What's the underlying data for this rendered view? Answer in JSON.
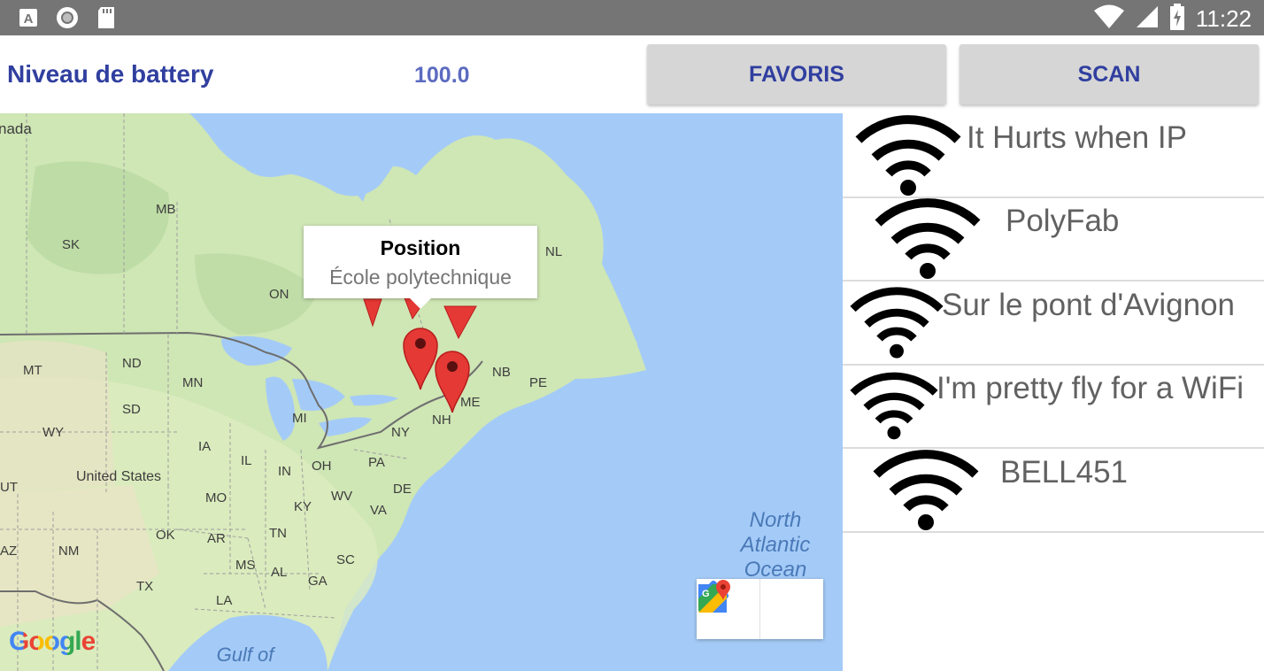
{
  "status_bar": {
    "time": "11:22",
    "left_icons": [
      "text-a-icon",
      "circle-icon",
      "sd-card-icon"
    ],
    "right_icons": [
      "wifi-signal-icon",
      "cell-signal-icon",
      "battery-charging-icon"
    ]
  },
  "header": {
    "battery_label": "Niveau de battery",
    "battery_value": "100.0",
    "favoris_label": "FAVORIS",
    "scan_label": "SCAN",
    "accent_color": "#303f9f"
  },
  "map": {
    "info_window": {
      "title": "Position",
      "subtitle": "École polytechnique"
    },
    "labels": {
      "canada": "nada",
      "mb": "MB",
      "sk": "SK",
      "on": "ON",
      "nl": "NL",
      "mt": "MT",
      "nd": "ND",
      "mn": "MN",
      "sd": "SD",
      "wy": "WY",
      "mi": "MI",
      "nb": "NB",
      "pe": "PE",
      "me": "ME",
      "nh": "NH",
      "ny": "NY",
      "ia": "IA",
      "il": "IL",
      "in": "IN",
      "oh": "OH",
      "pa": "PA",
      "ut": "UT",
      "us": "United States",
      "de": "DE",
      "mo": "MO",
      "ky": "KY",
      "wv": "WV",
      "va": "VA",
      "ok": "OK",
      "ar": "AR",
      "tn": "TN",
      "az": "AZ",
      "nm": "NM",
      "ms": "MS",
      "al": "AL",
      "sc": "SC",
      "ga": "GA",
      "tx": "TX",
      "la": "LA"
    },
    "ocean_label": "North\nAtlantic\nOcean",
    "gulf_label": "Gulf of\nMexico",
    "logo": "Google",
    "toolbar": [
      "directions-icon",
      "google-maps-icon"
    ]
  },
  "wifi_networks": [
    {
      "name": "It Hurts when IP"
    },
    {
      "name": "PolyFab"
    },
    {
      "name": "Sur le pont d'Avignon"
    },
    {
      "name": "I'm pretty fly for a WiFi"
    },
    {
      "name": "BELL451"
    }
  ]
}
